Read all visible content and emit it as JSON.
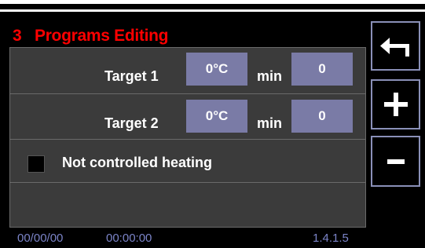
{
  "header": {
    "title": "3   Programs Editing"
  },
  "targets": [
    {
      "label": "Target 1",
      "temperature": "0°C",
      "unit": "min",
      "minutes": "0"
    },
    {
      "label": "Target 2",
      "temperature": "0°C",
      "unit": "min",
      "minutes": "0"
    }
  ],
  "heating": {
    "label": "Not controlled heating",
    "checked": false
  },
  "side_buttons": {
    "back_icon": "back-arrow-icon",
    "plus_icon": "plus-icon",
    "minus_icon": "minus-icon"
  },
  "status": {
    "date": "00/00/00",
    "time": "00:00:00",
    "version": "1.4.1.5"
  },
  "colors": {
    "title": "#ff0000",
    "panel": "#3b3b3b",
    "value_box": "#7a7ba6",
    "button_border": "#8a90b8",
    "status_text": "#7b84c8"
  }
}
